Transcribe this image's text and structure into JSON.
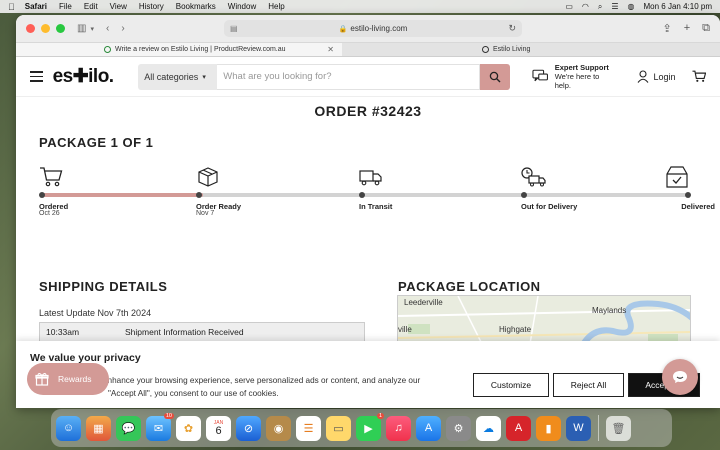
{
  "menubar": {
    "app": "Safari",
    "items": [
      "File",
      "Edit",
      "View",
      "History",
      "Bookmarks",
      "Window",
      "Help"
    ],
    "clock": "Mon 6 Jan  4:10 pm"
  },
  "browser": {
    "address": "estilo-living.com",
    "tabs": [
      {
        "title": "Write a review on Estilo Living | ProductReview.com.au",
        "active": true
      },
      {
        "title": "Estilo Living",
        "active": false
      }
    ]
  },
  "header": {
    "logo": "es✚ilo.",
    "category_label": "All categories",
    "search_placeholder": "What are you looking for?",
    "support_title": "Expert Support",
    "support_sub": "We're here to help.",
    "login_label": "Login"
  },
  "order": {
    "title": "ORDER #32423",
    "package_title": "PACKAGE 1 OF 1",
    "progress_fraction": 0.25,
    "steps": [
      {
        "label": "Ordered",
        "date": "Oct 26",
        "icon": "cart-icon"
      },
      {
        "label": "Order Ready",
        "date": "Nov 7",
        "icon": "box-icon"
      },
      {
        "label": "In Transit",
        "date": "",
        "icon": "truck-icon"
      },
      {
        "label": "Out for Delivery",
        "date": "",
        "icon": "delivery-truck-clock-icon"
      },
      {
        "label": "Delivered",
        "date": "",
        "icon": "box-check-icon"
      }
    ]
  },
  "shipping": {
    "heading": "SHIPPING DETAILS",
    "latest_update": "Latest Update Nov 7th 2024",
    "rows": [
      {
        "time": "10:33am",
        "status": "Shipment Information Received"
      }
    ]
  },
  "location": {
    "heading": "PACKAGE LOCATION",
    "map_labels": [
      "Leederville",
      "ville",
      "Highgate",
      "Maylands"
    ]
  },
  "cookie": {
    "title": "We value your privacy",
    "text_line1": "enhance your browsing experience, serve personalized ads or content, and analyze our",
    "text_line2": "\"Accept All\", you consent to our use of cookies.",
    "customize": "Customize",
    "reject": "Reject All",
    "accept": "Accept All"
  },
  "rewards_label": "Rewards",
  "dock": {
    "mail_badge": "10",
    "calendar_month": "JAN",
    "calendar_day": "6",
    "facetime_badge": "1"
  },
  "colors": {
    "accent": "#d39a96",
    "track_gray": "#d3d3d3"
  }
}
